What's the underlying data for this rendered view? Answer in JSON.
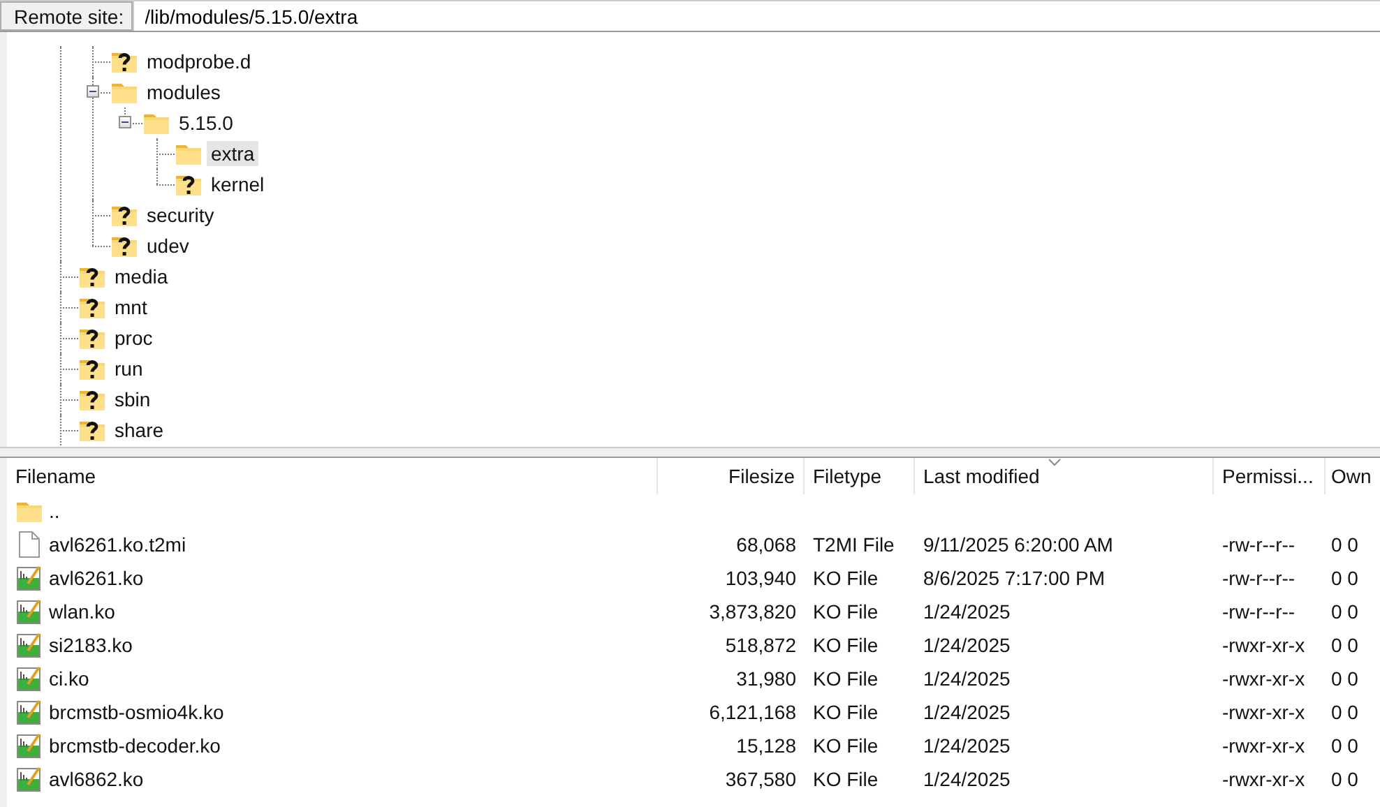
{
  "address_bar": {
    "label": "Remote site:",
    "value": "/lib/modules/5.15.0/extra"
  },
  "tree": [
    {
      "children": [
        {
          "label": "modprobe.d",
          "kind": "unknown",
          "selected": false
        },
        {
          "label": "modules",
          "kind": "folder",
          "expanded": true,
          "selected": false,
          "children": [
            {
              "label": "5.15.0",
              "kind": "folder",
              "expanded": true,
              "selected": false,
              "children": [
                {
                  "label": "extra",
                  "kind": "folder",
                  "selected": true
                },
                {
                  "label": "kernel",
                  "kind": "unknown",
                  "selected": false
                }
              ]
            }
          ]
        },
        {
          "label": "security",
          "kind": "unknown",
          "selected": false
        },
        {
          "label": "udev",
          "kind": "unknown",
          "selected": false
        }
      ]
    },
    {
      "label": "media",
      "kind": "unknown",
      "selected": false
    },
    {
      "label": "mnt",
      "kind": "unknown",
      "selected": false
    },
    {
      "label": "proc",
      "kind": "unknown",
      "selected": false
    },
    {
      "label": "run",
      "kind": "unknown",
      "selected": false
    },
    {
      "label": "sbin",
      "kind": "unknown",
      "selected": false
    },
    {
      "label": "share",
      "kind": "unknown",
      "selected": false
    }
  ],
  "file_list": {
    "columns": [
      {
        "label": "Filename",
        "sorted": false
      },
      {
        "label": "Filesize",
        "sorted": false
      },
      {
        "label": "Filetype",
        "sorted": false
      },
      {
        "label": "Last modified",
        "sorted": true
      },
      {
        "label": "Permissi...",
        "sorted": false
      },
      {
        "label": "Own",
        "sorted": false
      }
    ],
    "rows": [
      {
        "kind": "folder",
        "cells": [
          "..",
          "",
          "",
          "",
          "",
          ""
        ]
      },
      {
        "kind": "file",
        "cells": [
          "avl6261.ko.t2mi",
          "68,068",
          "T2MI File",
          "9/11/2025 6:20:00 AM",
          "-rw-r--r--",
          "0 0"
        ]
      },
      {
        "kind": "module",
        "cells": [
          "avl6261.ko",
          "103,940",
          "KO File",
          "8/6/2025 7:17:00 PM",
          "-rw-r--r--",
          "0 0"
        ]
      },
      {
        "kind": "module",
        "cells": [
          "wlan.ko",
          "3,873,820",
          "KO File",
          "1/24/2025",
          "-rw-r--r--",
          "0 0"
        ]
      },
      {
        "kind": "module",
        "cells": [
          "si2183.ko",
          "518,872",
          "KO File",
          "1/24/2025",
          "-rwxr-xr-x",
          "0 0"
        ]
      },
      {
        "kind": "module",
        "cells": [
          "ci.ko",
          "31,980",
          "KO File",
          "1/24/2025",
          "-rwxr-xr-x",
          "0 0"
        ]
      },
      {
        "kind": "module",
        "cells": [
          "brcmstb-osmio4k.ko",
          "6,121,168",
          "KO File",
          "1/24/2025",
          "-rwxr-xr-x",
          "0 0"
        ]
      },
      {
        "kind": "module",
        "cells": [
          "brcmstb-decoder.ko",
          "15,128",
          "KO File",
          "1/24/2025",
          "-rwxr-xr-x",
          "0 0"
        ]
      },
      {
        "kind": "module",
        "cells": [
          "avl6862.ko",
          "367,580",
          "KO File",
          "1/24/2025",
          "-rwxr-xr-x",
          "0 0"
        ]
      }
    ]
  }
}
